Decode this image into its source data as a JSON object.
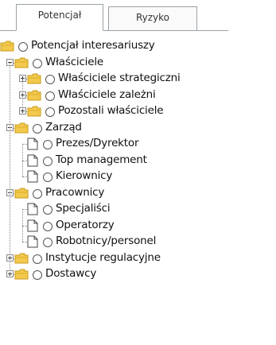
{
  "tabs": [
    {
      "label": "Potencjał",
      "active": true
    },
    {
      "label": "Ryzyko",
      "active": false
    }
  ],
  "tree": [
    {
      "label": "Potencjał interesariuszy",
      "type": "folder",
      "level": 0,
      "expander": null
    },
    {
      "label": "Właściciele",
      "type": "folder",
      "level": 1,
      "expander": "minus"
    },
    {
      "label": "Właściciele strategiczni",
      "type": "folder",
      "level": 2,
      "expander": "plus"
    },
    {
      "label": "Właściciele zależni",
      "type": "folder",
      "level": 2,
      "expander": "plus"
    },
    {
      "label": "Pozostali właściciele",
      "type": "folder",
      "level": 2,
      "expander": "plus"
    },
    {
      "label": "Zarząd",
      "type": "folder",
      "level": 1,
      "expander": "minus"
    },
    {
      "label": "Prezes/Dyrektor",
      "type": "doc",
      "level": 2,
      "expander": null
    },
    {
      "label": "Top management",
      "type": "doc",
      "level": 2,
      "expander": null
    },
    {
      "label": "Kierownicy",
      "type": "doc",
      "level": 2,
      "expander": null
    },
    {
      "label": "Pracownicy",
      "type": "folder",
      "level": 1,
      "expander": "minus"
    },
    {
      "label": "Specjaliści",
      "type": "doc",
      "level": 2,
      "expander": null
    },
    {
      "label": "Operatorzy",
      "type": "doc",
      "level": 2,
      "expander": null
    },
    {
      "label": "Robotnicy/personel",
      "type": "doc",
      "level": 2,
      "expander": null
    },
    {
      "label": "Instytucje regulacyjne",
      "type": "folder",
      "level": 1,
      "expander": "plus"
    },
    {
      "label": "Dostawcy",
      "type": "folder",
      "level": 1,
      "expander": "plus"
    }
  ],
  "icons": {
    "folder": "folder-icon",
    "doc": "document-icon",
    "radio": "radio-button"
  },
  "colors": {
    "folder_fill": "#f2c94c",
    "folder_edge": "#c99b1a",
    "tab_border": "#9aa0a6"
  }
}
